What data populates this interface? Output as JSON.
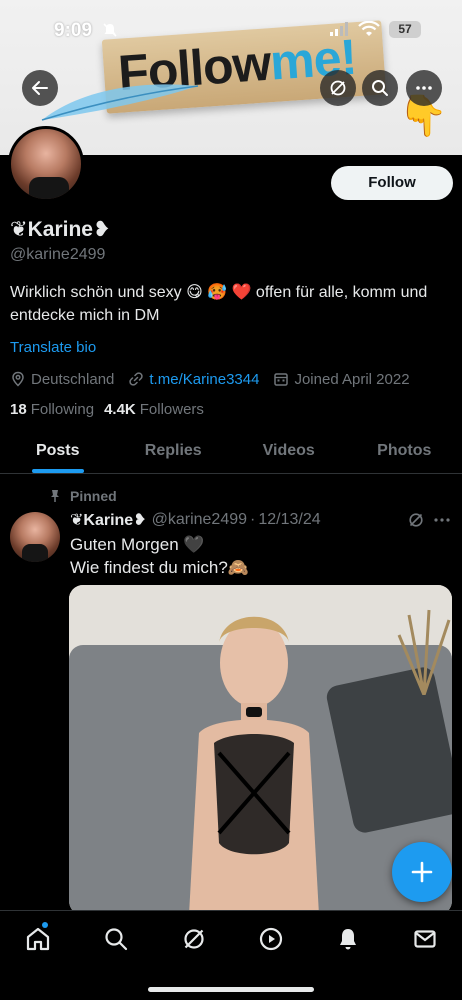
{
  "status_bar": {
    "time": "9:09",
    "battery": "57"
  },
  "banner": {
    "text_main": "Follow",
    "text_accent": "me!"
  },
  "profile": {
    "display_name": "❦Karine❥",
    "handle": "@karine2499",
    "follow_label": "Follow",
    "bio": "Wirklich schön und sexy 😋 🥵 ❤️ offen für alle, komm und entdecke mich in DM",
    "translate_label": "Translate bio",
    "location": "Deutschland",
    "link": "t.me/Karine3344",
    "joined": "Joined April 2022",
    "following_count": "18",
    "following_label": "Following",
    "followers_count": "4.4K",
    "followers_label": "Followers"
  },
  "tabs": [
    {
      "label": "Posts",
      "active": true
    },
    {
      "label": "Replies",
      "active": false
    },
    {
      "label": "Videos",
      "active": false
    },
    {
      "label": "Photos",
      "active": false
    }
  ],
  "post": {
    "pinned_label": "Pinned",
    "name": "❦Karine❥",
    "handle": "@karine2499",
    "date": "12/13/24",
    "text_line1": "Guten Morgen 🖤",
    "text_line2": "Wie findest du mich?🙈"
  },
  "icons": {
    "back": "arrow-left-icon",
    "grok": "grok-icon",
    "search": "search-icon",
    "more": "more-icon",
    "home": "home-icon",
    "nav_search": "search-icon",
    "nav_grok": "grok-icon",
    "video": "play-icon",
    "notifications": "bell-icon",
    "messages": "mail-icon",
    "compose": "plus-icon"
  },
  "colors": {
    "accent": "#1d9bf0",
    "background": "#000000",
    "text": "#e7e9ea",
    "muted": "#71767b"
  }
}
